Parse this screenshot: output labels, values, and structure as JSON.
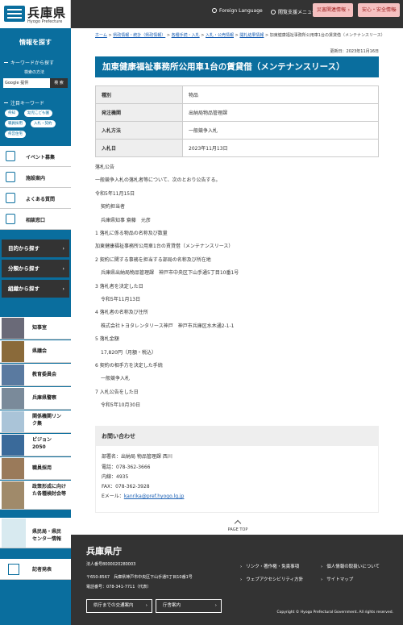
{
  "header": {
    "logo_text": "兵庫県",
    "logo_sub": "Hyogo Prefecture",
    "foreign_language": "Foreign Language",
    "browse_support": "閲覧支援メニュー",
    "disaster_button": "災害関連情報",
    "safety_button": "安心・安全情報"
  },
  "sidebar": {
    "title": "情報を探す",
    "keyword_search_heading": "キーワードから探す",
    "advanced_search": "検索の方法",
    "search_placeholder": "Google 提供",
    "search_button": "検 索",
    "hot_keywords_heading": "注目キーワード",
    "tags": [
      "県知",
      "幼児こども園",
      "職員採用",
      "入札・契約",
      "県営住宅"
    ],
    "items": [
      {
        "label": "イベント募集",
        "icon": "megaphone-icon"
      },
      {
        "label": "施設案内",
        "icon": "building-icon"
      },
      {
        "label": "よくある質問",
        "icon": "question-icon"
      },
      {
        "label": "相談窓口",
        "icon": "person-icon"
      }
    ],
    "browse": [
      {
        "label": "目的から探す"
      },
      {
        "label": "分類から探す"
      },
      {
        "label": "組織から探す"
      }
    ],
    "photo_links": [
      {
        "label": "知事室"
      },
      {
        "label": "県議会"
      },
      {
        "label": "教育委員会"
      },
      {
        "label": "兵庫県警察"
      },
      {
        "label": "関係機関リンク集"
      },
      {
        "label": "ビジョン2050"
      },
      {
        "label": "職員採用"
      },
      {
        "label": "政策形成に向けた各種検討会等"
      }
    ],
    "center_link": "県民局・県民センター情報",
    "press_link": "記者発表"
  },
  "breadcrumb": {
    "items": [
      "ホーム",
      "県政情報・統計（県政情報）",
      "各種手続・入札",
      "入札・公売情報",
      "開札結果情報"
    ],
    "current": "加東健康福祉事務所公用車1台の賃貸借（メンテナンスリース）"
  },
  "update_date": "更新日：2023年11月16日",
  "page_title": "加東健康福祉事務所公用車1台の賃貸借（メンテナンスリース）",
  "info_table": [
    {
      "key": "種別",
      "value": "物品"
    },
    {
      "key": "発注機関",
      "value": "出納局物品管理課"
    },
    {
      "key": "入札方法",
      "value": "一般競争入札"
    },
    {
      "key": "入札日",
      "value": "2023年11月13日"
    }
  ],
  "body": [
    {
      "text": "落札公告",
      "indent": false
    },
    {
      "text": "一般競争入札の落札者等について、次のとおり公告する。",
      "indent": false
    },
    {
      "text": "令和5年11月15日",
      "indent": false
    },
    {
      "text": "契約担当者",
      "indent": true
    },
    {
      "text": "兵庫県知事 齋藤　元彦",
      "indent": true
    },
    {
      "text": "1 落札に係る物品の名称及び数量",
      "indent": false
    },
    {
      "text": "加東健康福祉事務所公用車1台の賃貸借（メンテナンスリース）",
      "indent": false
    },
    {
      "text": "2 契約に関する事務を担当する部局の名称及び所在地",
      "indent": false
    },
    {
      "text": "兵庫県出納局物品管理課　神戸市中央区下山手通5丁目10番1号",
      "indent": true
    },
    {
      "text": "3 落札者を決定した日",
      "indent": false
    },
    {
      "text": "令和5年11月13日",
      "indent": true
    },
    {
      "text": "4 落札者の名称及び住所",
      "indent": false
    },
    {
      "text": "株式会社トヨタレンタリース神戸　神戸市兵庫区水木通2-1-1",
      "indent": true
    },
    {
      "text": "5 落札金額",
      "indent": false
    },
    {
      "text": "17,820円（月額・税込）",
      "indent": true
    },
    {
      "text": "6 契約の相手方を決定した手続",
      "indent": false
    },
    {
      "text": "一般競争入札",
      "indent": true
    },
    {
      "text": "7 入札公告をした日",
      "indent": false
    },
    {
      "text": "令和5年10月30日",
      "indent": true
    }
  ],
  "contact": {
    "heading": "お問い合わせ",
    "dept": "部署名：出納局 物品管理課 西川",
    "phone": "電話：078-362-3666",
    "ext": "内線：4935",
    "fax": "FAX：078-362-3928",
    "email_label": "Eメール：",
    "email": "kanrika@pref.hyogo.lg.jp"
  },
  "page_top": "PAGE TOP",
  "footer": {
    "name": "兵庫県庁",
    "corp_no": "法人番号8000020280003",
    "address": "〒650-8567　兵庫県神戸市中央区下山手通5丁目10番1号",
    "phone": "電話番号：078-341-7711（代表）",
    "access_button": "県庁までの交通案内",
    "map_button": "庁舎案内",
    "links": [
      "リンク・著作権・免責事項",
      "個人情報の取扱いについて",
      "ウェブアクセシビリティ方針",
      "サイトマップ"
    ],
    "copyright": "Copyright © Hyogo Prefectural Government. All rights reserved."
  },
  "colors": {
    "brand": "#0a6e9e",
    "dark": "#333333",
    "alert": "#f5c0c0"
  }
}
